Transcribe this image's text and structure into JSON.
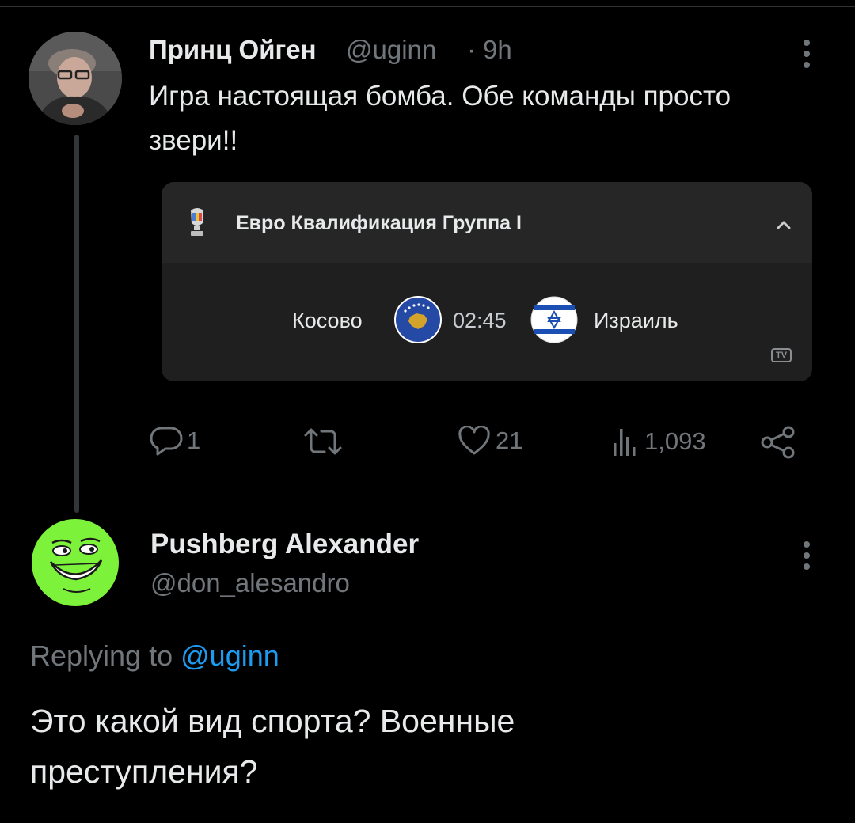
{
  "tweet": {
    "author_name": "Принц Ойген",
    "author_handle": "@uginn",
    "separator": "·",
    "time": "9h",
    "text_line1": "Игра настоящая бомба. Обе команды просто",
    "text_line2": "звери!!",
    "card": {
      "title": "Евро Квалификация Группа I",
      "home_team": "Косово",
      "away_team": "Израиль",
      "match_time": "02:45",
      "tv_badge": "TV",
      "home_flag_icon": "kosovo-flag-icon",
      "away_flag_icon": "israel-flag-icon",
      "league_icon": "euro-trophy-icon"
    },
    "actions": {
      "reply_count": "1",
      "retweet_count": "",
      "like_count": "21",
      "views_count": "1,093"
    }
  },
  "reply": {
    "author_name": "Pushberg Alexander",
    "author_handle": "@don_alesandro",
    "replying_prefix": "Replying to",
    "replying_mention": "@uginn",
    "text_line1": "Это какой вид спорта? Военные",
    "text_line2": "преступления?"
  },
  "colors": {
    "background": "#000000",
    "text": "#e7e9ea",
    "muted": "#71767b",
    "accent": "#1d9bf0",
    "card": "#1f1f1f"
  }
}
